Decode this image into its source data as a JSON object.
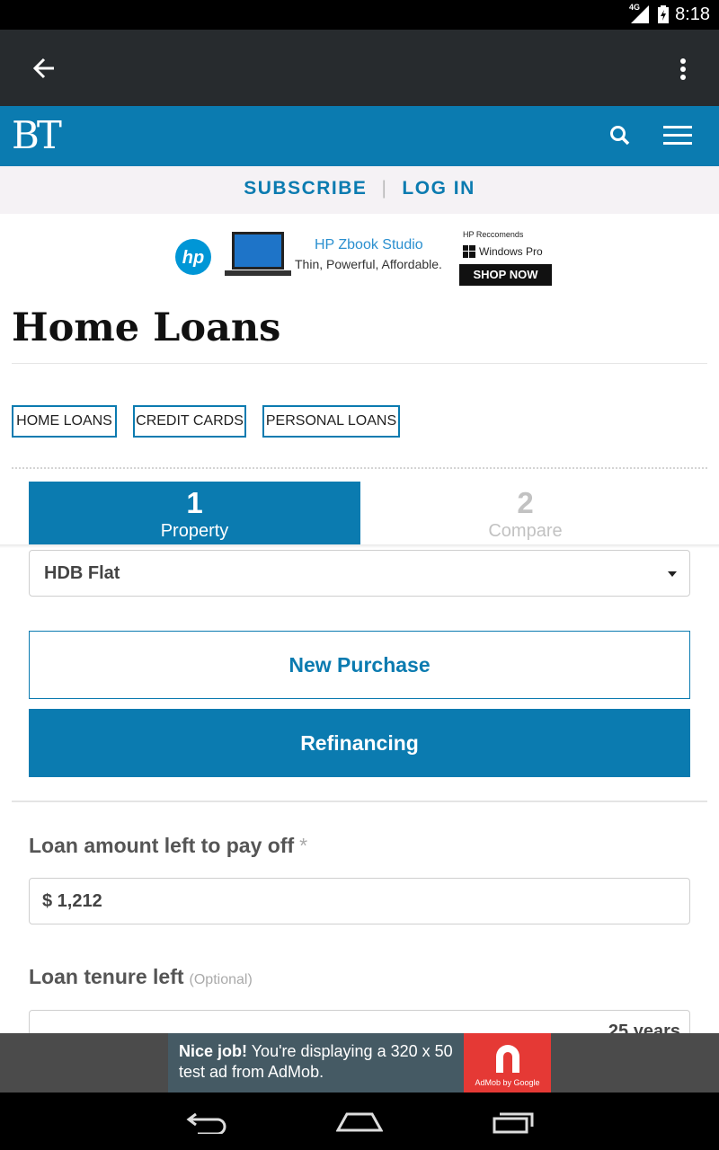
{
  "status_bar": {
    "network": "4G",
    "time": "8:18"
  },
  "brand": {
    "logo_text": "BT",
    "accent_color": "#0b7bb0"
  },
  "subscription_bar": {
    "subscribe_label": "SUBSCRIBE",
    "separator": "|",
    "login_label": "LOG IN"
  },
  "ad_banner": {
    "product_title": "HP Zbook Studio",
    "product_tagline": "Thin, Powerful, Affordable.",
    "recommends": "HP Reccomends",
    "windows_label": "Windows Pro",
    "cta": "SHOP NOW",
    "hp_logo": "hp"
  },
  "page": {
    "title": "Home Loans"
  },
  "category_tabs": [
    "HOME LOANS",
    "CREDIT CARDS",
    "PERSONAL LOANS"
  ],
  "steps": [
    {
      "number": "1",
      "label": "Property"
    },
    {
      "number": "2",
      "label": "Compare"
    }
  ],
  "property_select": {
    "value": "HDB Flat"
  },
  "purchase_type": {
    "new_purchase_label": "New Purchase",
    "refinancing_label": "Refinancing"
  },
  "loan_amount": {
    "label": "Loan amount left to pay off",
    "required_mark": "*",
    "value": "$ 1,212"
  },
  "loan_tenure": {
    "label": "Loan tenure left",
    "optional_label": "(Optional)",
    "value": "25 years"
  },
  "admob_ad": {
    "headline": "Nice job!",
    "text": "You're displaying a 320 x 50 test ad from AdMob.",
    "logo_caption": "AdMob by Google"
  }
}
